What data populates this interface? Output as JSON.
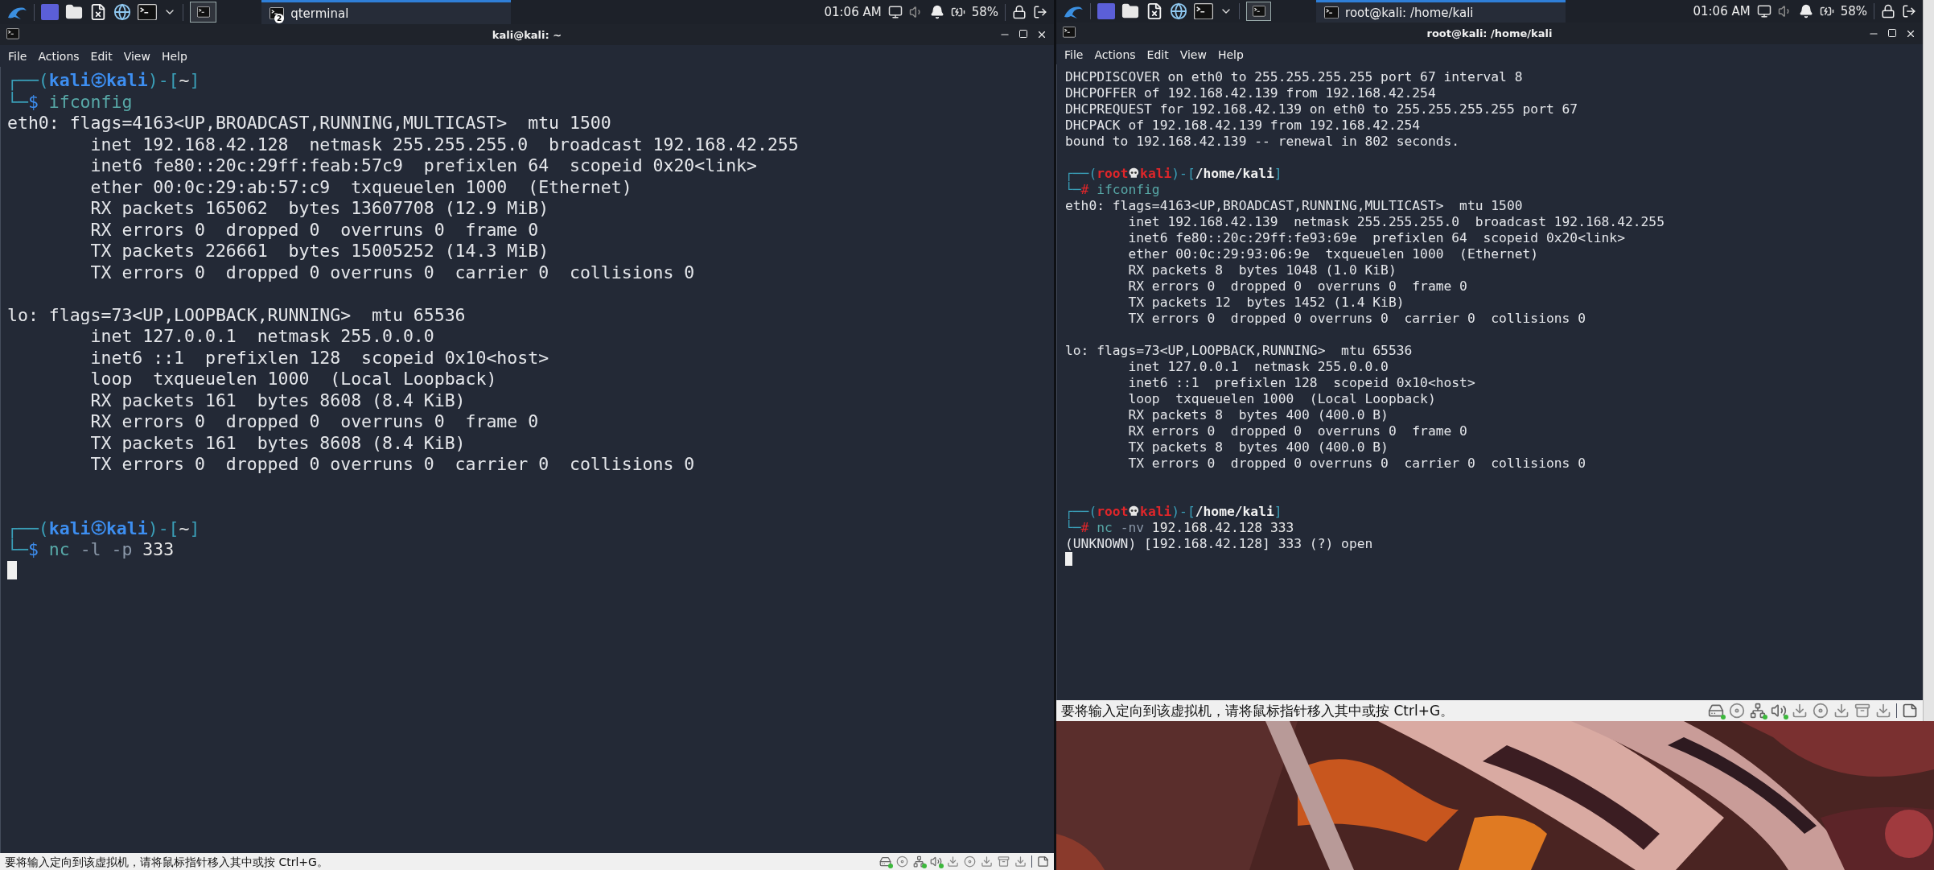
{
  "vms": [
    {
      "taskbar": {
        "task": {
          "label": "qterminal",
          "badge": "2"
        },
        "clock": "01:06 AM",
        "battery": "58%"
      },
      "window": {
        "title": "kali@kali: ~",
        "menu": [
          "File",
          "Actions",
          "Edit",
          "View",
          "Help"
        ]
      },
      "terminal": {
        "lines": [
          {
            "kind": "prompt",
            "segments": [
              {
                "kind": "frame",
                "text": "┌──("
              },
              {
                "kind": "user",
                "text": "kali"
              },
              {
                "kind": "at_mark"
              },
              {
                "kind": "host",
                "text": "kali"
              },
              {
                "kind": "frame",
                "text": ")-["
              },
              {
                "kind": "path",
                "text": "~"
              },
              {
                "kind": "frame",
                "text": "]"
              }
            ]
          },
          {
            "kind": "command",
            "segments": [
              {
                "kind": "frame",
                "text": "└─"
              },
              {
                "kind": "symbol",
                "text": "$ "
              },
              {
                "kind": "command",
                "text": "ifconfig"
              }
            ]
          },
          {
            "kind": "output",
            "text": "eth0: flags=4163<UP,BROADCAST,RUNNING,MULTICAST>  mtu 1500"
          },
          {
            "kind": "output",
            "text": "        inet 192.168.42.128  netmask 255.255.255.0  broadcast 192.168.42.255"
          },
          {
            "kind": "output",
            "text": "        inet6 fe80::20c:29ff:feab:57c9  prefixlen 64  scopeid 0x20<link>"
          },
          {
            "kind": "output",
            "text": "        ether 00:0c:29:ab:57:c9  txqueuelen 1000  (Ethernet)"
          },
          {
            "kind": "output",
            "text": "        RX packets 165062  bytes 13607708 (12.9 MiB)"
          },
          {
            "kind": "output",
            "text": "        RX errors 0  dropped 0  overruns 0  frame 0"
          },
          {
            "kind": "output",
            "text": "        TX packets 226661  bytes 15005252 (14.3 MiB)"
          },
          {
            "kind": "output",
            "text": "        TX errors 0  dropped 0 overruns 0  carrier 0  collisions 0"
          },
          {
            "kind": "blank"
          },
          {
            "kind": "output",
            "text": "lo: flags=73<UP,LOOPBACK,RUNNING>  mtu 65536"
          },
          {
            "kind": "output",
            "text": "        inet 127.0.0.1  netmask 255.0.0.0"
          },
          {
            "kind": "output",
            "text": "        inet6 ::1  prefixlen 128  scopeid 0x10<host>"
          },
          {
            "kind": "output",
            "text": "        loop  txqueuelen 1000  (Local Loopback)"
          },
          {
            "kind": "output",
            "text": "        RX packets 161  bytes 8608 (8.4 KiB)"
          },
          {
            "kind": "output",
            "text": "        RX errors 0  dropped 0  overruns 0  frame 0"
          },
          {
            "kind": "output",
            "text": "        TX packets 161  bytes 8608 (8.4 KiB)"
          },
          {
            "kind": "output",
            "text": "        TX errors 0  dropped 0 overruns 0  carrier 0  collisions 0"
          },
          {
            "kind": "blank"
          },
          {
            "kind": "blank"
          },
          {
            "kind": "prompt",
            "segments": [
              {
                "kind": "frame",
                "text": "┌──("
              },
              {
                "kind": "user",
                "text": "kali"
              },
              {
                "kind": "at_mark"
              },
              {
                "kind": "host",
                "text": "kali"
              },
              {
                "kind": "frame",
                "text": ")-["
              },
              {
                "kind": "path",
                "text": "~"
              },
              {
                "kind": "frame",
                "text": "]"
              }
            ]
          },
          {
            "kind": "command",
            "segments": [
              {
                "kind": "frame",
                "text": "└─"
              },
              {
                "kind": "symbol",
                "text": "$ "
              },
              {
                "kind": "command",
                "text": "nc "
              },
              {
                "kind": "option",
                "text": "-l -p "
              },
              {
                "kind": "argument",
                "text": "333"
              }
            ]
          },
          {
            "kind": "cursor"
          }
        ]
      },
      "status_bar": {
        "message": "要将输入定向到该虚拟机，请将鼠标指针移入其中或按 Ctrl+G。"
      }
    },
    {
      "taskbar": {
        "task": {
          "label": "root@kali: /home/kali"
        },
        "clock": "01:06 AM",
        "battery": "58%"
      },
      "window": {
        "title": "root@kali: /home/kali",
        "menu": [
          "File",
          "Actions",
          "Edit",
          "View",
          "Help"
        ]
      },
      "terminal": {
        "lines": [
          {
            "kind": "output",
            "text": "DHCPDISCOVER on eth0 to 255.255.255.255 port 67 interval 8"
          },
          {
            "kind": "output",
            "text": "DHCPOFFER of 192.168.42.139 from 192.168.42.254"
          },
          {
            "kind": "output",
            "text": "DHCPREQUEST for 192.168.42.139 on eth0 to 255.255.255.255 port 67"
          },
          {
            "kind": "output",
            "text": "DHCPACK of 192.168.42.139 from 192.168.42.254"
          },
          {
            "kind": "output",
            "text": "bound to 192.168.42.139 -- renewal in 802 seconds."
          },
          {
            "kind": "blank"
          },
          {
            "kind": "prompt",
            "segments": [
              {
                "kind": "frame",
                "text": "┌──("
              },
              {
                "kind": "root_user",
                "text": "root"
              },
              {
                "kind": "skull_mark"
              },
              {
                "kind": "root_host",
                "text": "kali"
              },
              {
                "kind": "frame",
                "text": ")-["
              },
              {
                "kind": "root_path",
                "text": "/home/kali"
              },
              {
                "kind": "frame",
                "text": "]"
              }
            ]
          },
          {
            "kind": "command",
            "segments": [
              {
                "kind": "frame",
                "text": "└─"
              },
              {
                "kind": "root_symbol",
                "text": "# "
              },
              {
                "kind": "command",
                "text": "ifconfig"
              }
            ]
          },
          {
            "kind": "output",
            "text": "eth0: flags=4163<UP,BROADCAST,RUNNING,MULTICAST>  mtu 1500"
          },
          {
            "kind": "output",
            "text": "        inet 192.168.42.139  netmask 255.255.255.0  broadcast 192.168.42.255"
          },
          {
            "kind": "output",
            "text": "        inet6 fe80::20c:29ff:fe93:69e  prefixlen 64  scopeid 0x20<link>"
          },
          {
            "kind": "output",
            "text": "        ether 00:0c:29:93:06:9e  txqueuelen 1000  (Ethernet)"
          },
          {
            "kind": "output",
            "text": "        RX packets 8  bytes 1048 (1.0 KiB)"
          },
          {
            "kind": "output",
            "text": "        RX errors 0  dropped 0  overruns 0  frame 0"
          },
          {
            "kind": "output",
            "text": "        TX packets 12  bytes 1452 (1.4 KiB)"
          },
          {
            "kind": "output",
            "text": "        TX errors 0  dropped 0 overruns 0  carrier 0  collisions 0"
          },
          {
            "kind": "blank"
          },
          {
            "kind": "output",
            "text": "lo: flags=73<UP,LOOPBACK,RUNNING>  mtu 65536"
          },
          {
            "kind": "output",
            "text": "        inet 127.0.0.1  netmask 255.0.0.0"
          },
          {
            "kind": "output",
            "text": "        inet6 ::1  prefixlen 128  scopeid 0x10<host>"
          },
          {
            "kind": "output",
            "text": "        loop  txqueuelen 1000  (Local Loopback)"
          },
          {
            "kind": "output",
            "text": "        RX packets 8  bytes 400 (400.0 B)"
          },
          {
            "kind": "output",
            "text": "        RX errors 0  dropped 0  overruns 0  frame 0"
          },
          {
            "kind": "output",
            "text": "        TX packets 8  bytes 400 (400.0 B)"
          },
          {
            "kind": "output",
            "text": "        TX errors 0  dropped 0 overruns 0  carrier 0  collisions 0"
          },
          {
            "kind": "blank"
          },
          {
            "kind": "blank"
          },
          {
            "kind": "prompt",
            "segments": [
              {
                "kind": "frame",
                "text": "┌──("
              },
              {
                "kind": "root_user",
                "text": "root"
              },
              {
                "kind": "skull_mark"
              },
              {
                "kind": "root_host",
                "text": "kali"
              },
              {
                "kind": "frame",
                "text": ")-["
              },
              {
                "kind": "root_path",
                "text": "/home/kali"
              },
              {
                "kind": "frame",
                "text": "]"
              }
            ]
          },
          {
            "kind": "command",
            "segments": [
              {
                "kind": "frame",
                "text": "└─"
              },
              {
                "kind": "root_symbol",
                "text": "# "
              },
              {
                "kind": "command",
                "text": "nc "
              },
              {
                "kind": "option",
                "text": "-nv "
              },
              {
                "kind": "argument",
                "text": "192.168.42.128 333"
              }
            ]
          },
          {
            "kind": "output",
            "text": "(UNKNOWN) [192.168.42.128] 333 (?) open"
          },
          {
            "kind": "cursor"
          }
        ]
      },
      "status_bar": {
        "message": "要将输入定向到该虚拟机，请将鼠标指针移入其中或按 Ctrl+G。"
      }
    }
  ]
}
